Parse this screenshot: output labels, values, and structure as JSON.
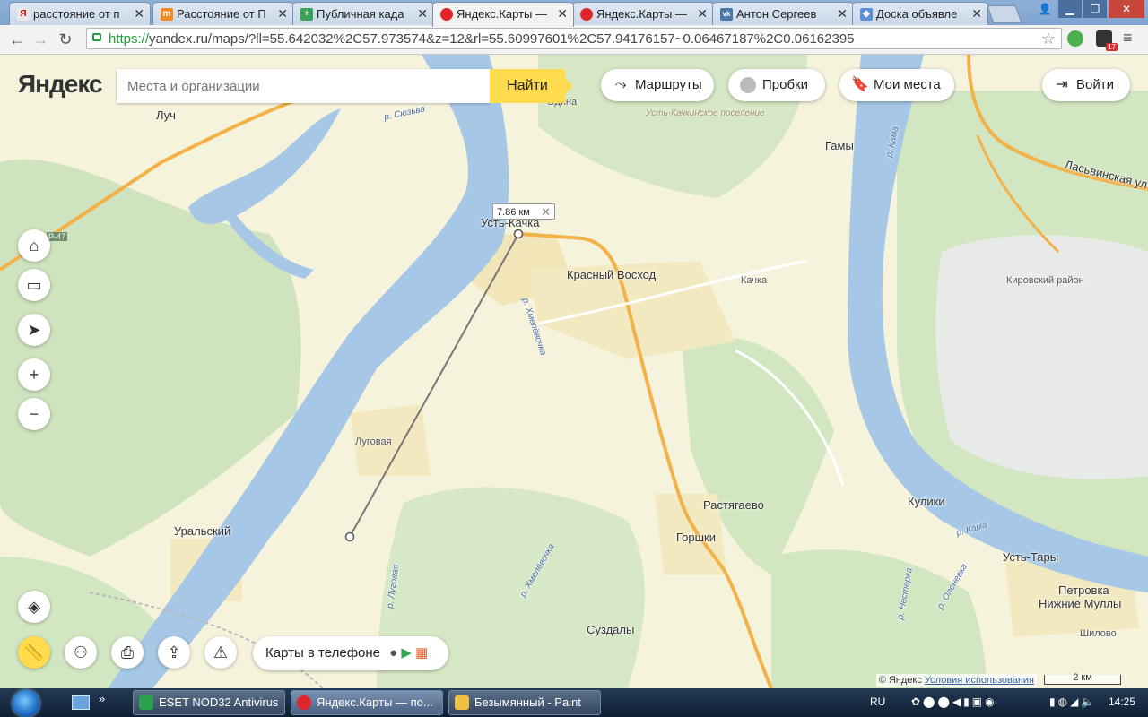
{
  "browser": {
    "tabs": [
      {
        "label": "расстояние от п",
        "favicon": "Я",
        "favicon_color": "#e8e8e8",
        "active": false
      },
      {
        "label": "Расстояние от П",
        "favicon": "m",
        "favicon_color": "#f08a24",
        "active": false
      },
      {
        "label": "Публичная када",
        "favicon": "+",
        "favicon_color": "#3ca25a",
        "active": false
      },
      {
        "label": "Яндекс.Карты —",
        "favicon": "●",
        "favicon_color": "#e0262b",
        "active": true
      },
      {
        "label": "Яндекс.Карты —",
        "favicon": "●",
        "favicon_color": "#e0262b",
        "active": false
      },
      {
        "label": "Антон Сергеев",
        "favicon": "vk",
        "favicon_color": "#4a76a8",
        "active": false
      },
      {
        "label": "Доска объявле",
        "favicon": "◆",
        "favicon_color": "#5a8fd6",
        "active": false
      }
    ],
    "url_scheme": "https://",
    "url_rest": "yandex.ru/maps/?ll=55.642032%2C57.973574&z=12&rl=55.60997601%2C57.94176157~0.06467187%2C0.06162395",
    "ext_badge": "17"
  },
  "map": {
    "logo": "Яндекс",
    "search_placeholder": "Места и организации",
    "find_label": "Найти",
    "routes_label": "Маршруты",
    "traffic_label": "Пробки",
    "places_label": "Мои места",
    "login_label": "Войти",
    "apps_label": "Карты в телефоне",
    "measure_distance": "7.86 км",
    "copyright": "© Яндекс",
    "terms_label": "Условия использования",
    "scale_label": "2 км",
    "places": [
      {
        "name": "Одина",
        "cls": "small"
      },
      {
        "name": "Луч",
        "cls": ""
      },
      {
        "name": "Усть-Качка",
        "cls": ""
      },
      {
        "name": "Красный Восход",
        "cls": ""
      },
      {
        "name": "Качка",
        "cls": "small"
      },
      {
        "name": "Гамы",
        "cls": ""
      },
      {
        "name": "Ласьвинская ул",
        "cls": ""
      },
      {
        "name": "Кировский район",
        "cls": "small"
      },
      {
        "name": "Луговая",
        "cls": "small"
      },
      {
        "name": "Уральский",
        "cls": ""
      },
      {
        "name": "Растягаево",
        "cls": ""
      },
      {
        "name": "Горшки",
        "cls": ""
      },
      {
        "name": "Кулики",
        "cls": ""
      },
      {
        "name": "Усть-Тары",
        "cls": ""
      },
      {
        "name": "Петровка",
        "cls": ""
      },
      {
        "name": "Нижние Муллы",
        "cls": ""
      },
      {
        "name": "Шилово",
        "cls": "small"
      },
      {
        "name": "Суздалы",
        "cls": ""
      },
      {
        "name": "Усть-Качкинское поселение",
        "cls": "small"
      },
      {
        "name": "р. Кама",
        "cls": "river"
      },
      {
        "name": "р. Кама",
        "cls": "river"
      },
      {
        "name": "р. Сюзьва",
        "cls": "river"
      },
      {
        "name": "р. Хмелёвочка",
        "cls": "river"
      },
      {
        "name": "р. Хмелёвочка",
        "cls": "river"
      },
      {
        "name": "р. Луговая",
        "cls": "river"
      },
      {
        "name": "р. Нестерка",
        "cls": "river"
      },
      {
        "name": "р. Оленевка",
        "cls": "river"
      },
      {
        "name": "Р-47",
        "cls": "small"
      }
    ]
  },
  "taskbar": {
    "items": [
      {
        "label": "ESET NOD32 Antivirus",
        "icon_color": "#2aa14b"
      },
      {
        "label": "Яндекс.Карты — по...",
        "icon_color": "#e0262b"
      },
      {
        "label": "Безымянный - Paint",
        "icon_color": "#f0c040"
      }
    ],
    "lang": "RU",
    "time": "14:25"
  }
}
